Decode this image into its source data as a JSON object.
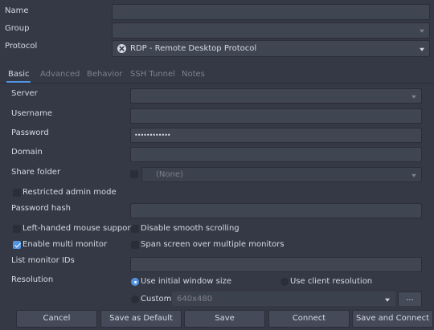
{
  "top": {
    "name_label": "Name",
    "group_label": "Group",
    "protocol_label": "Protocol",
    "name_value": "",
    "group_value": "",
    "protocol_value": "RDP - Remote Desktop Protocol"
  },
  "tabs": [
    {
      "label": "Basic",
      "active": true
    },
    {
      "label": "Advanced",
      "active": false
    },
    {
      "label": "Behavior",
      "active": false
    },
    {
      "label": "SSH Tunnel",
      "active": false
    },
    {
      "label": "Notes",
      "active": false
    }
  ],
  "basic": {
    "server_label": "Server",
    "server_value": "",
    "username_label": "Username",
    "username_value": "",
    "password_label": "Password",
    "password_value": "••••••••••••",
    "domain_label": "Domain",
    "domain_value": "",
    "share_folder_label": "Share folder",
    "share_folder_value": "(None)",
    "restricted_admin_label": "Restricted admin mode",
    "restricted_admin_checked": false,
    "password_hash_label": "Password hash",
    "password_hash_value": "",
    "left_handed_label": "Left-handed mouse support",
    "left_handed_checked": false,
    "disable_smooth_label": "Disable smooth scrolling",
    "disable_smooth_checked": false,
    "multi_monitor_label": "Enable multi monitor",
    "multi_monitor_checked": true,
    "span_screen_label": "Span screen over multiple monitors",
    "span_screen_checked": false,
    "monitor_ids_label": "List monitor IDs",
    "monitor_ids_value": "",
    "resolution_label": "Resolution",
    "use_initial_label": "Use initial window size",
    "use_client_label": "Use client resolution",
    "custom_label": "Custom",
    "custom_value": "640x480",
    "custom_more_label": "...",
    "selected_resolution": "use_initial"
  },
  "buttons": {
    "cancel": "Cancel",
    "save_default": "Save as Default",
    "save": "Save",
    "connect": "Connect",
    "save_connect": "Save and Connect"
  },
  "colors": {
    "background": "#353945",
    "field": "#404552",
    "accent": "#5294e2",
    "text": "#d3dae3",
    "text_dim": "#7c818c"
  }
}
